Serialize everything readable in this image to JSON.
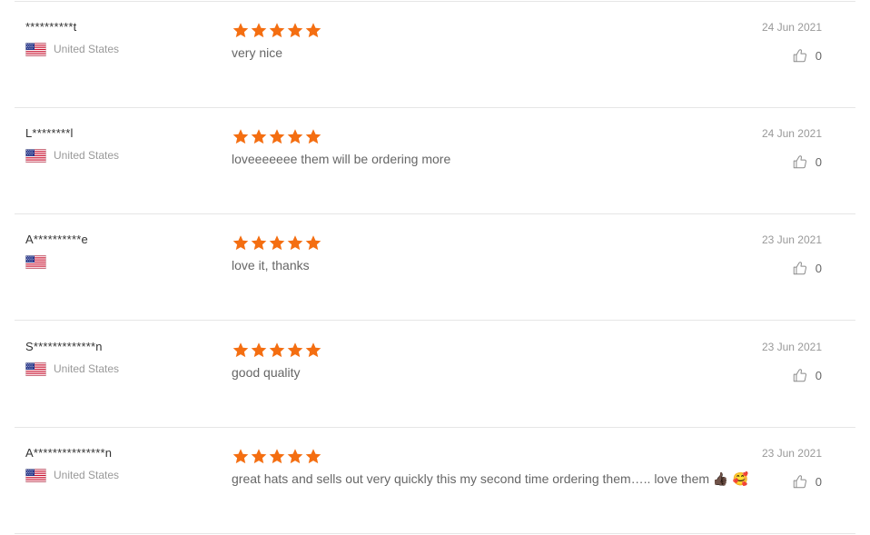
{
  "colors": {
    "star": "#f46e11",
    "divider": "#e6e6e6",
    "muted": "#999999"
  },
  "reviews": [
    {
      "user": "**********t",
      "country": "United States",
      "rating": 5,
      "text": "very nice",
      "emoji": "",
      "date": "24 Jun 2021",
      "likes": "0"
    },
    {
      "user": "L********l",
      "country": "United States",
      "rating": 5,
      "text": "loveeeeeee them will be ordering more",
      "emoji": "",
      "date": "24 Jun 2021",
      "likes": "0"
    },
    {
      "user": "A**********e",
      "country": "",
      "rating": 5,
      "text": "love it, thanks",
      "emoji": "",
      "date": "23 Jun 2021",
      "likes": "0"
    },
    {
      "user": "S*************n",
      "country": "United States",
      "rating": 5,
      "text": "good quality",
      "emoji": "",
      "date": "23 Jun 2021",
      "likes": "0"
    },
    {
      "user": "A***************n",
      "country": "United States",
      "rating": 5,
      "text": "great hats and sells out very quickly this my second time ordering them….. love them",
      "emoji": "👍🏿 🥰",
      "date": "23 Jun 2021",
      "likes": "0"
    }
  ]
}
